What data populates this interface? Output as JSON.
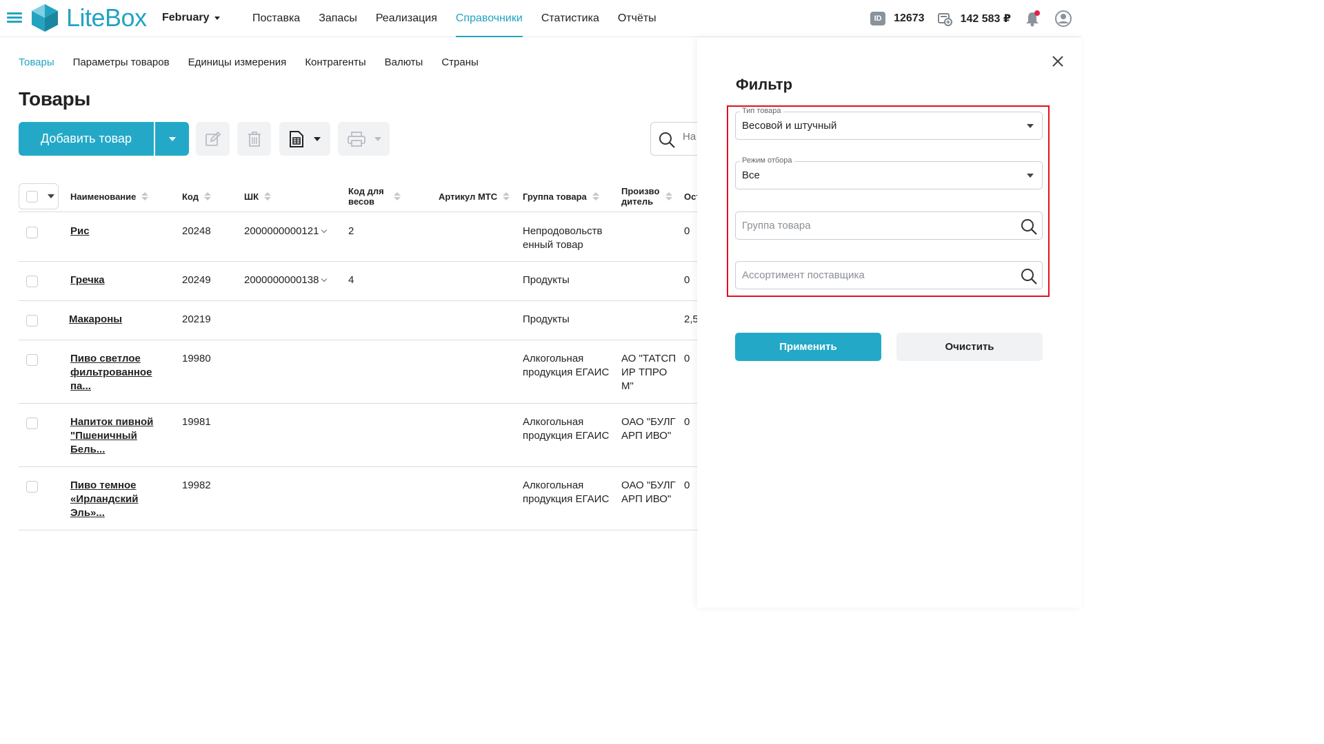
{
  "header": {
    "logo_text": "LiteBox",
    "month": "February",
    "nav": [
      "Поставка",
      "Запасы",
      "Реализация",
      "Справочники",
      "Статистика",
      "Отчёты"
    ],
    "active_nav": "Справочники",
    "id_badge": "ID",
    "id_value": "12673",
    "balance": "142 583 ₽",
    "accent_color": "#23a3c1"
  },
  "subnav": [
    "Товары",
    "Параметры товаров",
    "Единицы измерения",
    "Контрагенты",
    "Валюты",
    "Страны"
  ],
  "active_subnav": "Товары",
  "page_title": "Товары",
  "toolbar": {
    "add_label": "Добавить товар",
    "search_placeholder": "На"
  },
  "table": {
    "columns": [
      "Наименование",
      "Код",
      "ШК",
      "Код для весов",
      "Артикул МТС",
      "Группа товара",
      "Производитель",
      "Ост"
    ],
    "rows": [
      {
        "name": "Рис",
        "code": "20248",
        "barcode": "2000000000121",
        "scale_code": "2",
        "mts": "",
        "group": "Непродовольств енный товар",
        "maker": "",
        "rest": "0"
      },
      {
        "name": "Гречка",
        "code": "20249",
        "barcode": "2000000000138",
        "scale_code": "4",
        "mts": "",
        "group": "Продукты",
        "maker": "",
        "rest": "0"
      },
      {
        "name": "Макароны",
        "code": "20219",
        "barcode": "",
        "scale_code": "",
        "mts": "",
        "group": "Продукты",
        "maker": "",
        "rest": "2,5"
      },
      {
        "name": "Пиво светлое фильтрованное па...",
        "code": "19980",
        "barcode": "",
        "scale_code": "",
        "mts": "",
        "group": "Алкогольная продукция ЕГАИС",
        "maker": "АО \"ТАТСПИР ТПРОМ\"",
        "rest": "0"
      },
      {
        "name": "Напиток пивной \"Пшеничный Бель...",
        "code": "19981",
        "barcode": "",
        "scale_code": "",
        "mts": "",
        "group": "Алкогольная продукция ЕГАИС",
        "maker": "ОАО \"БУЛГАРП ИВО\"",
        "rest": "0"
      },
      {
        "name": "Пиво темное «Ирландский Эль»...",
        "code": "19982",
        "barcode": "",
        "scale_code": "",
        "mts": "",
        "group": "Алкогольная продукция ЕГАИС",
        "maker": "ОАО \"БУЛГАРП ИВО\"",
        "rest": "0"
      }
    ]
  },
  "filter": {
    "title": "Фильтр",
    "product_type_label": "Тип товара",
    "product_type_value": "Весовой и штучный",
    "mode_label": "Режим отбора",
    "mode_value": "Все",
    "group_placeholder": "Группа товара",
    "supplier_placeholder": "Ассортимент поставщика",
    "apply_label": "Применить",
    "clear_label": "Очистить"
  }
}
